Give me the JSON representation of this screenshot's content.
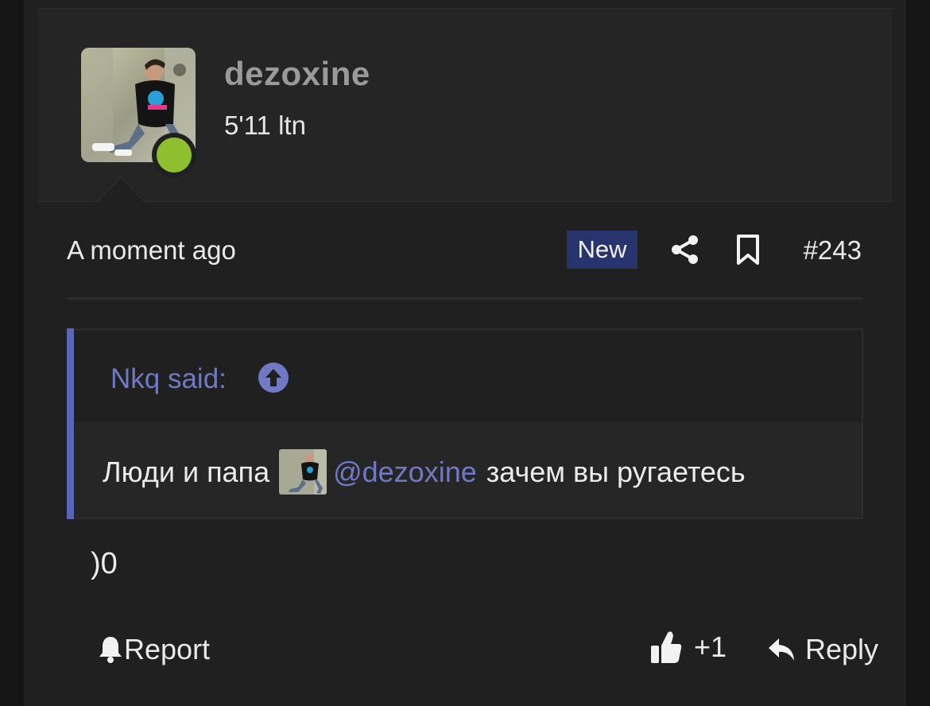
{
  "user": {
    "name": "dezoxine",
    "title": "5'11 ltn",
    "avatar_icon": "user-photo",
    "online": true,
    "online_color": "#8dbf2e"
  },
  "meta": {
    "time": "A moment ago",
    "badge": "New",
    "share_icon": "share-icon",
    "bookmark_icon": "bookmark-icon",
    "post_number": "#243"
  },
  "quote": {
    "author": "Nkq said:",
    "up_icon": "arrow-up-circle-icon",
    "text_before": "Люди и папа",
    "mention": "@dezoxine",
    "text_after": "зачем вы ругаетесь",
    "accent": "#5b66b6"
  },
  "post": {
    "body": ")0"
  },
  "footer": {
    "report_label": "Report",
    "like_count": "+1",
    "reply_label": "Reply"
  }
}
